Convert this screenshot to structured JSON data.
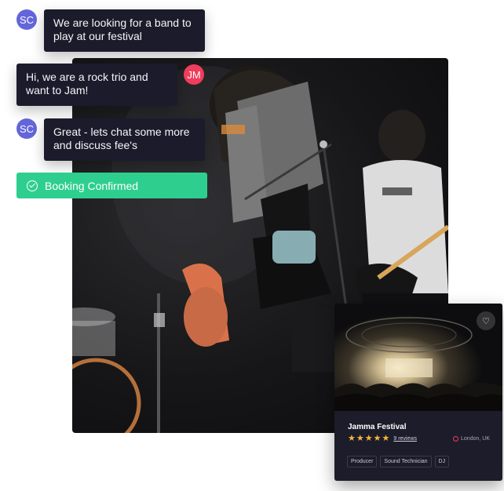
{
  "chat": {
    "messages": [
      {
        "sender_initials": "SC",
        "text_line1": "We are looking for a band to",
        "text_line2": "play at our festival"
      },
      {
        "sender_initials": "JM",
        "text_line1": "Hi, we are a rock trio and",
        "text_line2": "want to Jam!"
      },
      {
        "sender_initials": "SC",
        "text_line1": "Great - lets chat some more",
        "text_line2": "and discuss fee's"
      }
    ],
    "booking_label": "Booking Confirmed"
  },
  "festival_card": {
    "title": "Jamma Festival",
    "rating": 5,
    "reviews": "9 reviews",
    "location": "London, UK",
    "tags": [
      "Producer",
      "Sound Technician",
      "DJ"
    ]
  },
  "colors": {
    "avatar_sc": "#6366d9",
    "avatar_jm": "#ef3d5c",
    "booking_green": "#2ecf8e",
    "star": "#f6b73c",
    "card_bg": "#1c1c2a"
  },
  "icons": {
    "booking": "check-circle-icon",
    "favorite": "heart-icon",
    "location": "map-pin-icon",
    "rating": "star-icon"
  }
}
